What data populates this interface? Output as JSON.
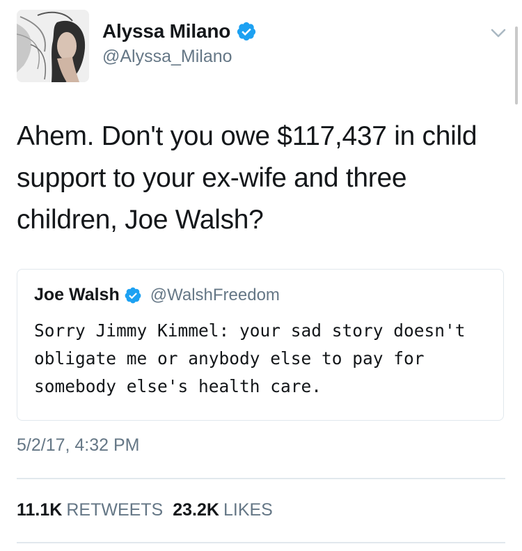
{
  "tweet": {
    "author": {
      "name": "Alyssa Milano",
      "handle": "@Alyssa_Milano",
      "verified": true,
      "avatar_icon": "profile-photo"
    },
    "text": "Ahem. Don't you owe $117,437 in child\nsupport to your ex-wife and three\nchildren, Joe Walsh?",
    "quoted_tweet": {
      "name": "Joe Walsh",
      "handle": "@WalshFreedom",
      "verified": true,
      "text": "Sorry Jimmy Kimmel: your sad story doesn't\nobligate me or anybody else to pay for\nsomebody else's health care."
    },
    "timestamp": "5/2/17, 4:32 PM",
    "stats": {
      "retweets_count": "11.1K",
      "retweets_label": "RETWEETS",
      "likes_count": "23.2K",
      "likes_label": "LIKES"
    }
  },
  "colors": {
    "text_primary": "#14171a",
    "text_secondary": "#657786",
    "verified_blue": "#1da1f2",
    "border": "#e1e8ed"
  },
  "icons": {
    "verified": "verified-badge-icon",
    "menu": "chevron-down-icon"
  }
}
